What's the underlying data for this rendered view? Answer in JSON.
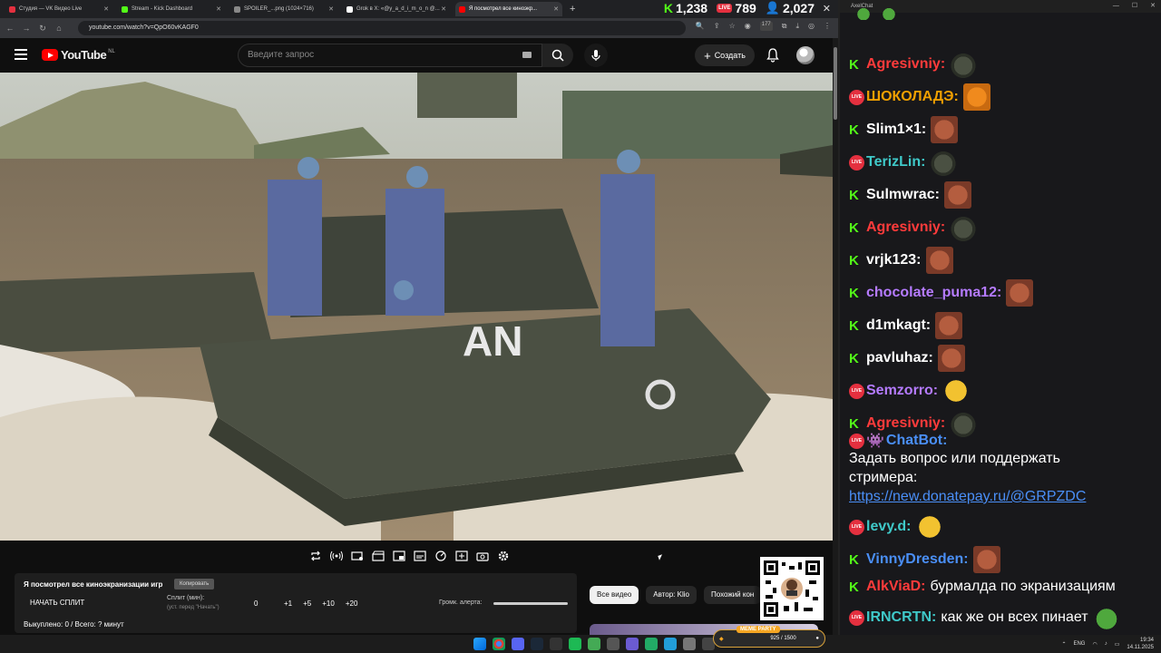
{
  "browser": {
    "tabs": [
      {
        "title": "Студия — VK Видео Live",
        "color": "#e4303f"
      },
      {
        "title": "Stream - Kick Dashboard",
        "color": "#53fc18"
      },
      {
        "title": "SPOILER_...png (1024×716)",
        "color": "#888888"
      },
      {
        "title": "Grok в X: «@y_a_d_i_m_o_n @...",
        "color": "#ffffff"
      },
      {
        "title": "Я посмотрел все киноэкр...",
        "color": "#ff0000"
      }
    ],
    "url": "youtube.com/watch?v=QpO60vKAGF0",
    "extension_badge": "177"
  },
  "stream_counters": {
    "kick_viewers": "1,238",
    "vk_viewers": "789",
    "total_viewers": "2,027",
    "live_badge": "LIVE"
  },
  "youtube": {
    "logo_text": "YouTube",
    "country": "NL",
    "search_placeholder": "Введите запрос",
    "create_label": "Создать",
    "chips": [
      "Все видео",
      "Автор: Klio",
      "Похожий кон"
    ]
  },
  "split_panel": {
    "title": "Я посмотрел все киноэкранизации игр",
    "copy_label": "Копировать",
    "start_label": "НАЧАТЬ СПЛИТ",
    "split_label": "Сплит (мин):",
    "split_hint": "(уст. перед \"Начать\")",
    "split_value": "0",
    "increments": [
      "+1",
      "+5",
      "+10",
      "+20"
    ],
    "alert_label": "Громк. алерта:",
    "status": "Выкуплено: 0 / Всего: ? минут"
  },
  "chat": {
    "window_title": "AxelChat",
    "messages": [
      {
        "platform": "kick",
        "user": "Agresivniy:",
        "color": "#ff3b3b",
        "emote": "seal"
      },
      {
        "platform": "vk",
        "user": "ШОКОЛАДЭ:",
        "color": "#f0a000",
        "emote": "tiger"
      },
      {
        "platform": "kick",
        "user": "Slim1×1:",
        "color": "#ffffff",
        "emote": "face"
      },
      {
        "platform": "vk",
        "user": "TerizLin:",
        "color": "#3fc9c9",
        "emote": "seal"
      },
      {
        "platform": "kick",
        "user": "Sulmwrac:",
        "color": "#ffffff",
        "emote": "face"
      },
      {
        "platform": "kick",
        "user": "Agresivniy:",
        "color": "#ff3b3b",
        "emote": "seal"
      },
      {
        "platform": "kick",
        "user": "vrjk123:",
        "color": "#ffffff",
        "emote": "face"
      },
      {
        "platform": "kick",
        "user": "chocolate_puma12:",
        "color": "#b57bff",
        "emote": "face"
      },
      {
        "platform": "kick",
        "user": "d1mkagt:",
        "color": "#ffffff",
        "emote": "face"
      },
      {
        "platform": "kick",
        "user": "pavluhaz:",
        "color": "#ffffff",
        "emote": "face"
      },
      {
        "platform": "vk",
        "user": "Semzorro:",
        "color": "#b57bff",
        "emote": "lol"
      },
      {
        "platform": "kick",
        "user": "Agresivniy:",
        "color": "#ff3b3b",
        "emote": "seal"
      }
    ],
    "bot": {
      "user": "ChatBot:",
      "line1": "Задать вопрос или поддержать",
      "line2": "стримера:",
      "link": "https://new.donatepay.ru/@GRPZDC"
    },
    "tail": [
      {
        "platform": "vk",
        "user": "levy.d:",
        "color": "#3fc9c9",
        "emote": "lol",
        "text": ""
      },
      {
        "platform": "kick",
        "user": "VinnyDresden:",
        "color": "#4a8ff7",
        "emote": "face",
        "text": ""
      },
      {
        "platform": "kick",
        "user": "AlkViaD:",
        "color": "#ff3b3b",
        "emote": "",
        "text": "бурмалда по экранизациям"
      },
      {
        "platform": "vk",
        "user": "IRNCRTN:",
        "color": "#3fc9c9",
        "emote": "pepe",
        "text": "как же он всех пинает"
      }
    ]
  },
  "taskbar": {
    "meme_label": "MEME PARTY",
    "meme_progress": "925 / 1500",
    "lang": "ENG",
    "time": "19:34",
    "date": "14.11.2025"
  }
}
